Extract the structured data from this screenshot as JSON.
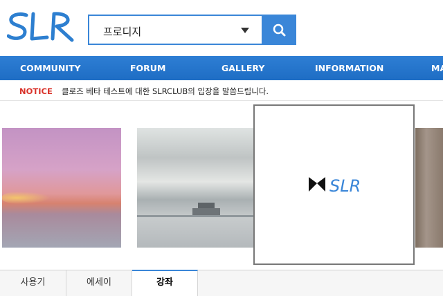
{
  "header": {
    "logo_text": "SLR",
    "search": {
      "value": "프로디지"
    }
  },
  "nav": {
    "items": [
      "COMMUNITY",
      "FORUM",
      "GALLERY",
      "INFORMATION",
      "MA"
    ]
  },
  "notice": {
    "label": "NOTICE",
    "text": "클로즈 베타 테스트에 대한 SLRCLUB의 입장을 말씀드립니다."
  },
  "gallery": {
    "featured_logo_text": "SLR"
  },
  "tabs": {
    "items": [
      "사용기",
      "에세이",
      "강좌"
    ],
    "active": "강좌"
  },
  "colors": {
    "brand_blue": "#3a86d8",
    "nav_blue": "#2878d0",
    "notice_red": "#d9322a"
  }
}
